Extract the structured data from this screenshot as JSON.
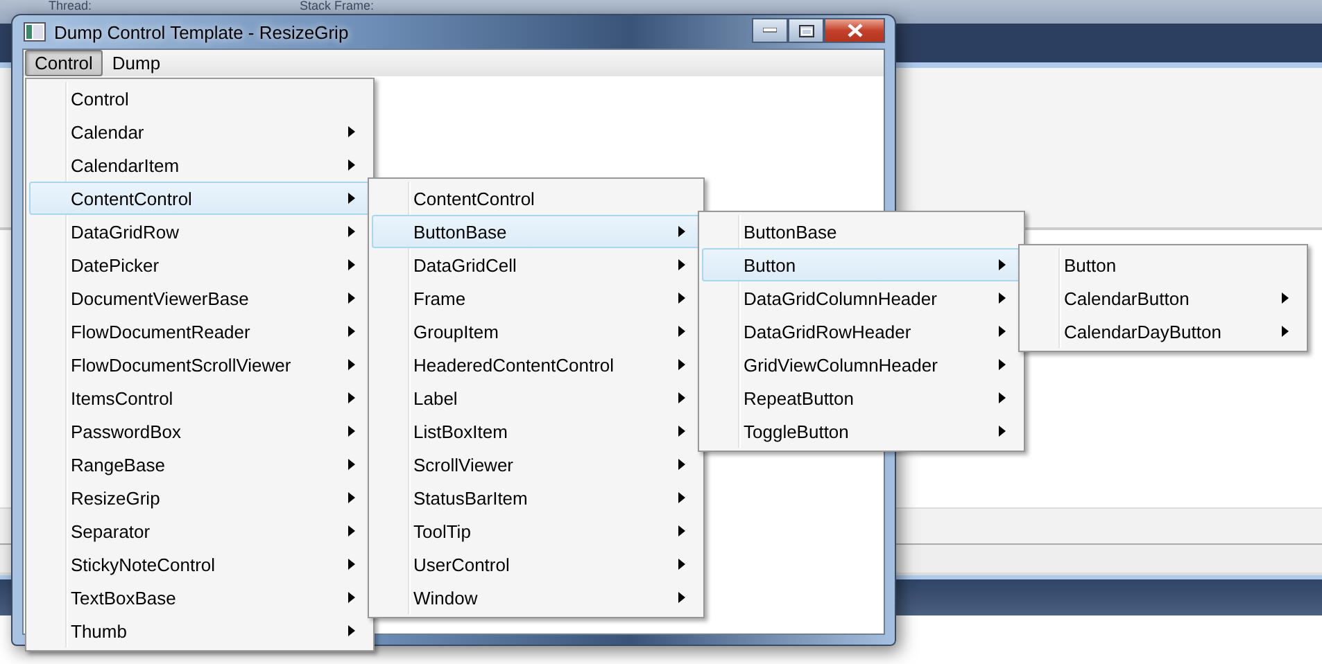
{
  "background": {
    "toolbar_labels": [
      "Thread:",
      "Stack Frame:"
    ]
  },
  "window": {
    "title": "Dump Control Template - ResizeGrip"
  },
  "menu_bar": [
    {
      "label": "Control",
      "selected": true
    },
    {
      "label": "Dump",
      "selected": false
    }
  ],
  "menus": [
    {
      "items": [
        {
          "label": "Control",
          "has_submenu": false,
          "selected": false
        },
        {
          "label": "Calendar",
          "has_submenu": true,
          "selected": false
        },
        {
          "label": "CalendarItem",
          "has_submenu": true,
          "selected": false
        },
        {
          "label": "ContentControl",
          "has_submenu": true,
          "selected": true
        },
        {
          "label": "DataGridRow",
          "has_submenu": true,
          "selected": false
        },
        {
          "label": "DatePicker",
          "has_submenu": true,
          "selected": false
        },
        {
          "label": "DocumentViewerBase",
          "has_submenu": true,
          "selected": false
        },
        {
          "label": "FlowDocumentReader",
          "has_submenu": true,
          "selected": false
        },
        {
          "label": "FlowDocumentScrollViewer",
          "has_submenu": true,
          "selected": false
        },
        {
          "label": "ItemsControl",
          "has_submenu": true,
          "selected": false
        },
        {
          "label": "PasswordBox",
          "has_submenu": true,
          "selected": false
        },
        {
          "label": "RangeBase",
          "has_submenu": true,
          "selected": false
        },
        {
          "label": "ResizeGrip",
          "has_submenu": true,
          "selected": false
        },
        {
          "label": "Separator",
          "has_submenu": true,
          "selected": false
        },
        {
          "label": "StickyNoteControl",
          "has_submenu": true,
          "selected": false
        },
        {
          "label": "TextBoxBase",
          "has_submenu": true,
          "selected": false
        },
        {
          "label": "Thumb",
          "has_submenu": true,
          "selected": false
        }
      ]
    },
    {
      "items": [
        {
          "label": "ContentControl",
          "has_submenu": false,
          "selected": false
        },
        {
          "label": "ButtonBase",
          "has_submenu": true,
          "selected": true
        },
        {
          "label": "DataGridCell",
          "has_submenu": true,
          "selected": false
        },
        {
          "label": "Frame",
          "has_submenu": true,
          "selected": false
        },
        {
          "label": "GroupItem",
          "has_submenu": true,
          "selected": false
        },
        {
          "label": "HeaderedContentControl",
          "has_submenu": true,
          "selected": false
        },
        {
          "label": "Label",
          "has_submenu": true,
          "selected": false
        },
        {
          "label": "ListBoxItem",
          "has_submenu": true,
          "selected": false
        },
        {
          "label": "ScrollViewer",
          "has_submenu": true,
          "selected": false
        },
        {
          "label": "StatusBarItem",
          "has_submenu": true,
          "selected": false
        },
        {
          "label": "ToolTip",
          "has_submenu": true,
          "selected": false
        },
        {
          "label": "UserControl",
          "has_submenu": true,
          "selected": false
        },
        {
          "label": "Window",
          "has_submenu": true,
          "selected": false
        }
      ]
    },
    {
      "items": [
        {
          "label": "ButtonBase",
          "has_submenu": false,
          "selected": false
        },
        {
          "label": "Button",
          "has_submenu": true,
          "selected": true
        },
        {
          "label": "DataGridColumnHeader",
          "has_submenu": true,
          "selected": false
        },
        {
          "label": "DataGridRowHeader",
          "has_submenu": true,
          "selected": false
        },
        {
          "label": "GridViewColumnHeader",
          "has_submenu": true,
          "selected": false
        },
        {
          "label": "RepeatButton",
          "has_submenu": true,
          "selected": false
        },
        {
          "label": "ToggleButton",
          "has_submenu": true,
          "selected": false
        }
      ]
    },
    {
      "items": [
        {
          "label": "Button",
          "has_submenu": false,
          "selected": false
        },
        {
          "label": "CalendarButton",
          "has_submenu": true,
          "selected": false
        },
        {
          "label": "CalendarDayButton",
          "has_submenu": true,
          "selected": false
        }
      ]
    }
  ]
}
